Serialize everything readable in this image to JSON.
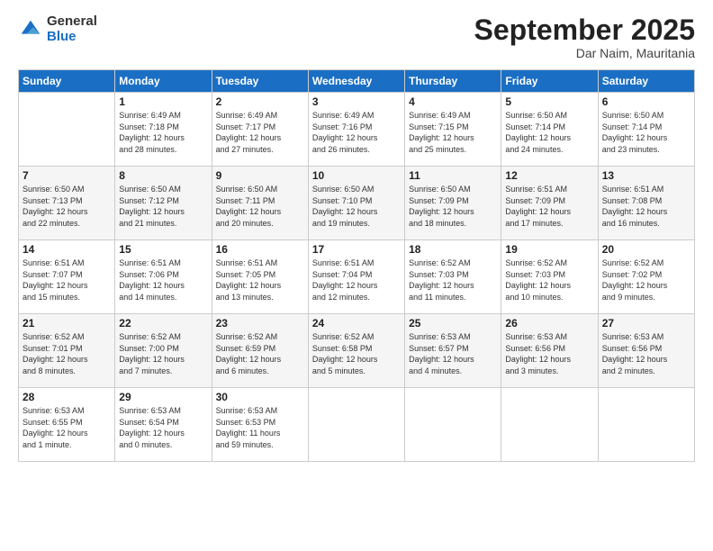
{
  "logo": {
    "general": "General",
    "blue": "Blue"
  },
  "header": {
    "month": "September 2025",
    "location": "Dar Naim, Mauritania"
  },
  "days": [
    "Sunday",
    "Monday",
    "Tuesday",
    "Wednesday",
    "Thursday",
    "Friday",
    "Saturday"
  ],
  "weeks": [
    [
      {
        "num": "",
        "info": ""
      },
      {
        "num": "1",
        "info": "Sunrise: 6:49 AM\nSunset: 7:18 PM\nDaylight: 12 hours\nand 28 minutes."
      },
      {
        "num": "2",
        "info": "Sunrise: 6:49 AM\nSunset: 7:17 PM\nDaylight: 12 hours\nand 27 minutes."
      },
      {
        "num": "3",
        "info": "Sunrise: 6:49 AM\nSunset: 7:16 PM\nDaylight: 12 hours\nand 26 minutes."
      },
      {
        "num": "4",
        "info": "Sunrise: 6:49 AM\nSunset: 7:15 PM\nDaylight: 12 hours\nand 25 minutes."
      },
      {
        "num": "5",
        "info": "Sunrise: 6:50 AM\nSunset: 7:14 PM\nDaylight: 12 hours\nand 24 minutes."
      },
      {
        "num": "6",
        "info": "Sunrise: 6:50 AM\nSunset: 7:14 PM\nDaylight: 12 hours\nand 23 minutes."
      }
    ],
    [
      {
        "num": "7",
        "info": "Sunrise: 6:50 AM\nSunset: 7:13 PM\nDaylight: 12 hours\nand 22 minutes."
      },
      {
        "num": "8",
        "info": "Sunrise: 6:50 AM\nSunset: 7:12 PM\nDaylight: 12 hours\nand 21 minutes."
      },
      {
        "num": "9",
        "info": "Sunrise: 6:50 AM\nSunset: 7:11 PM\nDaylight: 12 hours\nand 20 minutes."
      },
      {
        "num": "10",
        "info": "Sunrise: 6:50 AM\nSunset: 7:10 PM\nDaylight: 12 hours\nand 19 minutes."
      },
      {
        "num": "11",
        "info": "Sunrise: 6:50 AM\nSunset: 7:09 PM\nDaylight: 12 hours\nand 18 minutes."
      },
      {
        "num": "12",
        "info": "Sunrise: 6:51 AM\nSunset: 7:09 PM\nDaylight: 12 hours\nand 17 minutes."
      },
      {
        "num": "13",
        "info": "Sunrise: 6:51 AM\nSunset: 7:08 PM\nDaylight: 12 hours\nand 16 minutes."
      }
    ],
    [
      {
        "num": "14",
        "info": "Sunrise: 6:51 AM\nSunset: 7:07 PM\nDaylight: 12 hours\nand 15 minutes."
      },
      {
        "num": "15",
        "info": "Sunrise: 6:51 AM\nSunset: 7:06 PM\nDaylight: 12 hours\nand 14 minutes."
      },
      {
        "num": "16",
        "info": "Sunrise: 6:51 AM\nSunset: 7:05 PM\nDaylight: 12 hours\nand 13 minutes."
      },
      {
        "num": "17",
        "info": "Sunrise: 6:51 AM\nSunset: 7:04 PM\nDaylight: 12 hours\nand 12 minutes."
      },
      {
        "num": "18",
        "info": "Sunrise: 6:52 AM\nSunset: 7:03 PM\nDaylight: 12 hours\nand 11 minutes."
      },
      {
        "num": "19",
        "info": "Sunrise: 6:52 AM\nSunset: 7:03 PM\nDaylight: 12 hours\nand 10 minutes."
      },
      {
        "num": "20",
        "info": "Sunrise: 6:52 AM\nSunset: 7:02 PM\nDaylight: 12 hours\nand 9 minutes."
      }
    ],
    [
      {
        "num": "21",
        "info": "Sunrise: 6:52 AM\nSunset: 7:01 PM\nDaylight: 12 hours\nand 8 minutes."
      },
      {
        "num": "22",
        "info": "Sunrise: 6:52 AM\nSunset: 7:00 PM\nDaylight: 12 hours\nand 7 minutes."
      },
      {
        "num": "23",
        "info": "Sunrise: 6:52 AM\nSunset: 6:59 PM\nDaylight: 12 hours\nand 6 minutes."
      },
      {
        "num": "24",
        "info": "Sunrise: 6:52 AM\nSunset: 6:58 PM\nDaylight: 12 hours\nand 5 minutes."
      },
      {
        "num": "25",
        "info": "Sunrise: 6:53 AM\nSunset: 6:57 PM\nDaylight: 12 hours\nand 4 minutes."
      },
      {
        "num": "26",
        "info": "Sunrise: 6:53 AM\nSunset: 6:56 PM\nDaylight: 12 hours\nand 3 minutes."
      },
      {
        "num": "27",
        "info": "Sunrise: 6:53 AM\nSunset: 6:56 PM\nDaylight: 12 hours\nand 2 minutes."
      }
    ],
    [
      {
        "num": "28",
        "info": "Sunrise: 6:53 AM\nSunset: 6:55 PM\nDaylight: 12 hours\nand 1 minute."
      },
      {
        "num": "29",
        "info": "Sunrise: 6:53 AM\nSunset: 6:54 PM\nDaylight: 12 hours\nand 0 minutes."
      },
      {
        "num": "30",
        "info": "Sunrise: 6:53 AM\nSunset: 6:53 PM\nDaylight: 11 hours\nand 59 minutes."
      },
      {
        "num": "",
        "info": ""
      },
      {
        "num": "",
        "info": ""
      },
      {
        "num": "",
        "info": ""
      },
      {
        "num": "",
        "info": ""
      }
    ]
  ]
}
